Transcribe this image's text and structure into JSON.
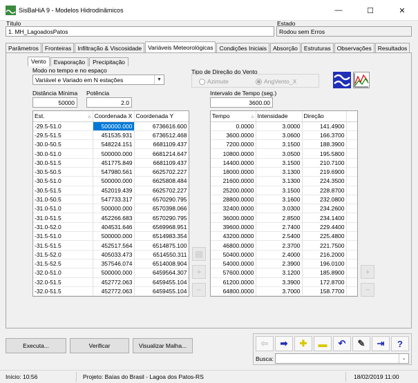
{
  "window": {
    "title": "SisBaHiA 9 - Modelos Hidrodinâmicos",
    "min": "—",
    "max": "☐",
    "close": "✕"
  },
  "header": {
    "titulo_label": "Título",
    "titulo_value": "1. MH_LagoadosPatos",
    "estado_label": "Estado",
    "estado_value": "Rodou sem Erros"
  },
  "tabs": [
    "Parâmetros",
    "Fronteiras",
    "Infiltração & Viscosidade",
    "Variáveis Meteorológicas",
    "Condições Iniciais",
    "Absorção",
    "Estruturas",
    "Observações",
    "Resultados"
  ],
  "subtabs": [
    "Vento",
    "Evaporação",
    "Precipitação"
  ],
  "modo": {
    "label": "Modo no tempo e no espaço",
    "value": "Variável e Variado em N estações"
  },
  "tipo_direcao": {
    "label": "Tipo de Direção do Vento",
    "option1": "Azimute",
    "option2": "AngVento_X"
  },
  "distancia": {
    "label": "Distância Mínima",
    "value": "50000"
  },
  "potencia": {
    "label": "Potência",
    "value": "2.0"
  },
  "intervalo": {
    "label": "Intervalo de Tempo (seg.)",
    "value": "3600.00"
  },
  "stations": {
    "headers": [
      "Est.",
      "Coordenada X",
      "Coordenada Y"
    ],
    "rows": [
      [
        "-29.5-51.0",
        "500000.000",
        "6736616.600"
      ],
      [
        "-29.5-51.5",
        "451535.931",
        "6736512.468"
      ],
      [
        "-30.0-50.5",
        "548224.151",
        "6681109.437"
      ],
      [
        "-30.0-51.0",
        "500000.000",
        "6681214.647"
      ],
      [
        "-30.0-51.5",
        "451775.849",
        "6681109.437"
      ],
      [
        "-30.5-50.5",
        "547980.561",
        "6625702.227"
      ],
      [
        "-30.5-51.0",
        "500000.000",
        "6625808.484"
      ],
      [
        "-30.5-51.5",
        "452019.439",
        "6625702.227"
      ],
      [
        "-31.0-50.5",
        "547733.317",
        "6570290.795"
      ],
      [
        "-31.0-51.0",
        "500000.000",
        "6570398.066"
      ],
      [
        "-31.0-51.5",
        "452266.683",
        "6570290.795"
      ],
      [
        "-31.0-52.0",
        "404531.646",
        "6569968.951"
      ],
      [
        "-31.5-51.0",
        "500000.000",
        "6514983.354"
      ],
      [
        "-31.5-51.5",
        "452517.564",
        "6514875.100"
      ],
      [
        "-31.5-52.0",
        "405033.473",
        "6514550.311"
      ],
      [
        "-31.5-52.5",
        "357546.074",
        "6514008.904"
      ],
      [
        "-32.0-51.0",
        "500000.000",
        "6459564.307"
      ],
      [
        "-32.0-51.5",
        "452772.063",
        "6459455.104"
      ],
      [
        "-32.0-51.5",
        "452772.063",
        "6459455.104"
      ]
    ]
  },
  "series": {
    "headers": [
      "Tempo",
      "Intensidade",
      "Direção"
    ],
    "rows": [
      [
        "0.0000",
        "3.0000",
        "141.4900"
      ],
      [
        "3600.0000",
        "3.0600",
        "166.3700"
      ],
      [
        "7200.0000",
        "3.1500",
        "188.3900"
      ],
      [
        "10800.0000",
        "3.0500",
        "195.5800"
      ],
      [
        "14400.0000",
        "3.1500",
        "210.7100"
      ],
      [
        "18000.0000",
        "3.1300",
        "219.6900"
      ],
      [
        "21600.0000",
        "3.1300",
        "224.3500"
      ],
      [
        "25200.0000",
        "3.1500",
        "228.8700"
      ],
      [
        "28800.0000",
        "3.1600",
        "232.0800"
      ],
      [
        "32400.0000",
        "3.0300",
        "234.2600"
      ],
      [
        "36000.0000",
        "2.8500",
        "234.1400"
      ],
      [
        "39600.0000",
        "2.7400",
        "229.4400"
      ],
      [
        "43200.0000",
        "2.5400",
        "225.4800"
      ],
      [
        "46800.0000",
        "2.3700",
        "221.7500"
      ],
      [
        "50400.0000",
        "2.4000",
        "216.2000"
      ],
      [
        "54000.0000",
        "2.3900",
        "196.0100"
      ],
      [
        "57600.0000",
        "3.1200",
        "185.8900"
      ],
      [
        "61200.0000",
        "3.3900",
        "172.8700"
      ],
      [
        "64800.0000",
        "3.7000",
        "158.7700"
      ]
    ]
  },
  "buttons": {
    "executa": "Executa...",
    "verificar": "Verificar",
    "visualizar": "Visualizar Malha..."
  },
  "busca_label": "Busca:",
  "statusbar": {
    "inicio": "Início: 10:56",
    "projeto": "Projeto: Baías do Brasil - Lagoa dos Patos-RS",
    "datetime": "18/02/2019 11:00"
  },
  "colors": {
    "selection": "#0078d7",
    "accent_blue": "#1f2fb7",
    "plus_yellow": "#e8d800"
  }
}
